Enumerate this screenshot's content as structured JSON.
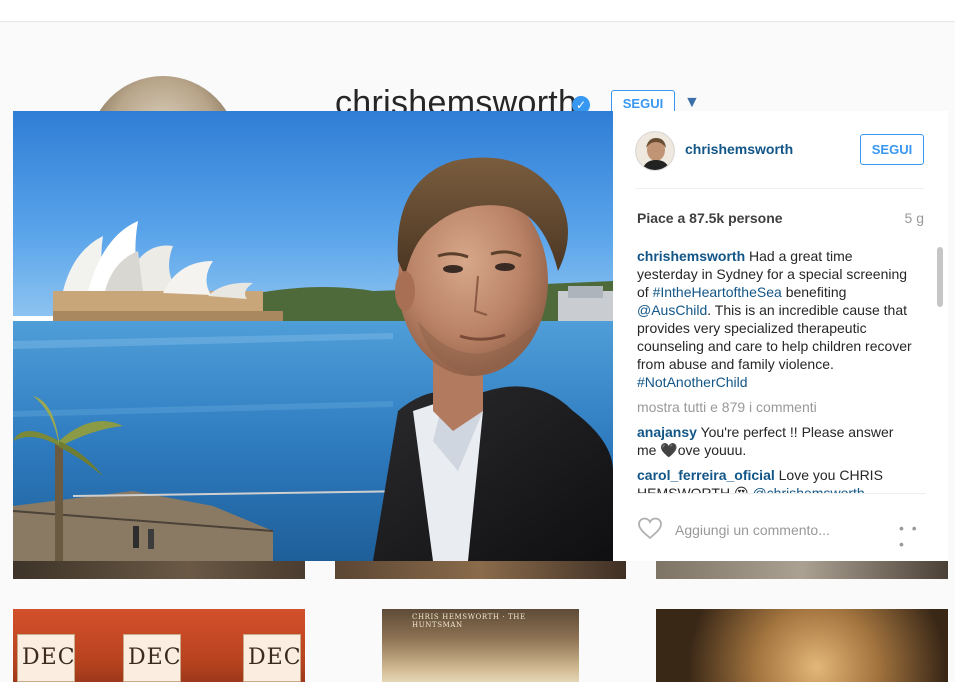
{
  "profile": {
    "username": "chrishemsworth",
    "verified_icon": "verified-badge-icon",
    "follow_label": "SEGUI",
    "dropdown_icon": "caret-down-icon"
  },
  "grid": {
    "dec_texts": [
      "DEC",
      "DEC",
      "DEC"
    ],
    "poster_text": "CHRIS HEMSWORTH · THE HUNTSMAN"
  },
  "post": {
    "username": "chrishemsworth",
    "follow_label": "SEGUI",
    "likes": "Piace a 87.5k persone",
    "age": "5 g",
    "caption": {
      "user": "chrishemsworth",
      "text_1": "Had a great time yesterday in Sydney for a special screening of",
      "hashtag_1": "#IntheHeartoftheSea",
      "text_2": "benefiting",
      "mention_1": "@AusChild",
      "text_3": ". This is an incredible cause that provides very specialized therapeutic counseling and care to help children recover from abuse and family violence.",
      "hashtag_2": "#NotAnotherChild"
    },
    "view_all": "mostra tutti e 879 i commenti",
    "comments": [
      {
        "user": "anajansy",
        "text": "You're perfect !! Please answer me 🖤ove youuu."
      },
      {
        "user": "carol_ferreira_oficial",
        "text": "Love you CHRIS HEMSWORTH 😍",
        "mention": "@chrishemsworth"
      }
    ],
    "comment_placeholder": "Aggiungi un commento...",
    "more_label": "• • •",
    "heart_icon": "heart-outline-icon"
  }
}
